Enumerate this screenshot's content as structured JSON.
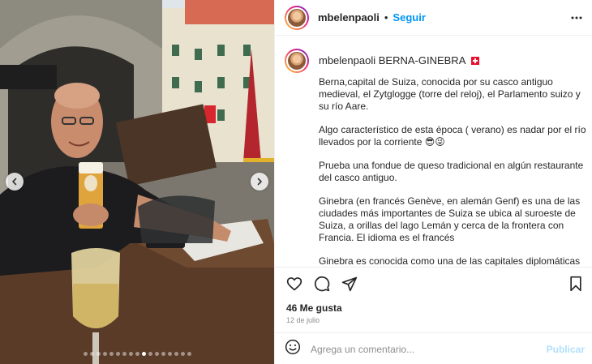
{
  "post": {
    "username": "mbelenpaoli",
    "separator": "•",
    "follow_label": "Seguir",
    "caption_location": "BERNA-GINEBRA",
    "paragraphs": [
      "Berna,capital de Suiza, conocida por su casco antiguo medieval, el Zytglogge (torre del reloj), el Parlamento suizo y su río Aare.",
      "Algo característico de esta época ( verano) es nadar por el río llevados por la corriente 😎😜",
      "Prueba una fondue de queso tradicional en algún restaurante del casco antiguo.",
      "Ginebra (en francés Genève, en alemán Genf) es una de las ciudades más importantes de Suiza se ubica al suroeste de Suiza, a orillas del lago Lemán y cerca de la frontera con Francia. El idioma es el francés",
      "Ginebra es conocida como una de las capitales diplomáticas del mundo, sede de muchas organizaciones internacionales"
    ],
    "likes": "46 Me gusta",
    "date": "12 de julio",
    "comment_placeholder": "Agrega un comentario...",
    "publish_label": "Publicar"
  },
  "carousel": {
    "dot_count": 17,
    "active_index": 9
  },
  "icons": {
    "like": "heart-icon",
    "comment": "comment-icon",
    "share": "share-icon",
    "save": "bookmark-icon",
    "more": "more-options-icon",
    "emoji": "emoji-icon"
  },
  "colors": {
    "accent": "#0095f6",
    "publish_disabled": "#b2dffc",
    "flag": "#e8112d"
  }
}
